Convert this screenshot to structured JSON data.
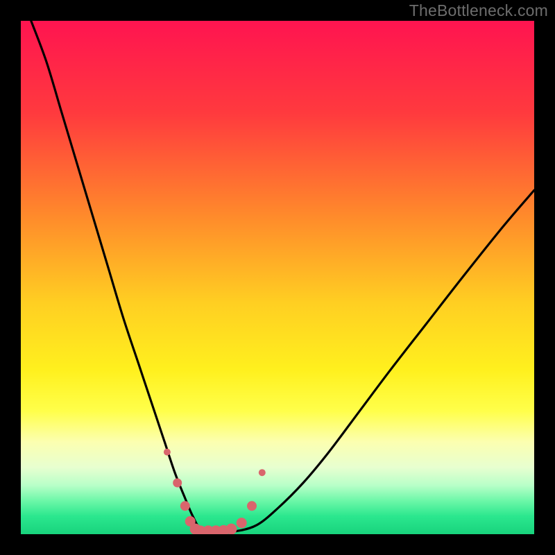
{
  "watermark": "TheBottleneck.com",
  "chart_data": {
    "type": "line",
    "title": "",
    "xlabel": "",
    "ylabel": "",
    "xlim": [
      0,
      100
    ],
    "ylim": [
      0,
      100
    ],
    "grid": false,
    "legend": false,
    "series": [
      {
        "name": "bottleneck-curve",
        "x": [
          2,
          5,
          8,
          11,
          14,
          17,
          20,
          23,
          26,
          28,
          30,
          32,
          33.5,
          35,
          38,
          42,
          46,
          50,
          55,
          60,
          66,
          72,
          79,
          86,
          94,
          100
        ],
        "y": [
          100,
          92,
          82,
          72,
          62,
          52,
          42,
          33,
          24,
          18,
          12,
          7,
          3.5,
          1.2,
          0.6,
          0.6,
          1.8,
          5,
          10,
          16,
          24,
          32,
          41,
          50,
          60,
          67
        ]
      }
    ],
    "markers": {
      "name": "highlight-points",
      "color": "#d9656c",
      "x": [
        28.5,
        30.5,
        32,
        33,
        34,
        35,
        36.5,
        38,
        39.5,
        41,
        43,
        45,
        47
      ],
      "y": [
        16,
        10,
        5.5,
        2.5,
        1.0,
        0.6,
        0.6,
        0.6,
        0.7,
        1.0,
        2.2,
        5.5,
        12
      ],
      "r": [
        5,
        6.5,
        7,
        7.5,
        8,
        8,
        8.2,
        8.2,
        8,
        8,
        7.5,
        7,
        5
      ]
    },
    "background_gradient": {
      "stops": [
        {
          "offset": 0.0,
          "color": "#ff1450"
        },
        {
          "offset": 0.18,
          "color": "#ff3a3e"
        },
        {
          "offset": 0.38,
          "color": "#ff8a2b"
        },
        {
          "offset": 0.55,
          "color": "#ffcf22"
        },
        {
          "offset": 0.68,
          "color": "#fff01e"
        },
        {
          "offset": 0.76,
          "color": "#ffff4a"
        },
        {
          "offset": 0.82,
          "color": "#fcffb0"
        },
        {
          "offset": 0.87,
          "color": "#e7ffd0"
        },
        {
          "offset": 0.905,
          "color": "#b8ffc8"
        },
        {
          "offset": 0.935,
          "color": "#6cf7a8"
        },
        {
          "offset": 0.965,
          "color": "#2be78e"
        },
        {
          "offset": 1.0,
          "color": "#18d37d"
        }
      ]
    }
  }
}
